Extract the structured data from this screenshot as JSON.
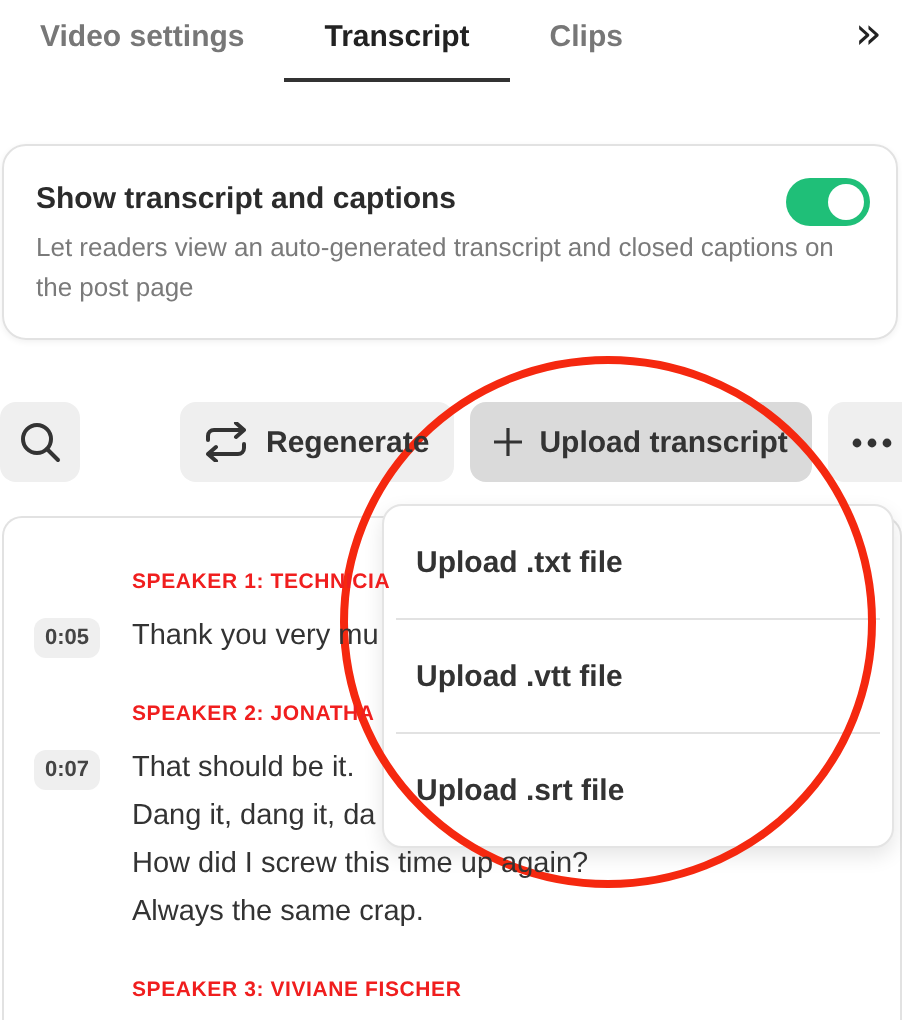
{
  "tabs": [
    {
      "label": "Video settings",
      "selected": false
    },
    {
      "label": "Transcript",
      "selected": true
    },
    {
      "label": "Clips",
      "selected": false
    }
  ],
  "tabs_more": "»",
  "setting": {
    "title": "Show transcript and captions",
    "description": "Let readers view an auto-generated transcript and closed captions on the post page",
    "on": true
  },
  "toolbar": {
    "regenerate": "Regenerate",
    "upload": "Upload transcript",
    "upload_open": true
  },
  "upload_menu": {
    "items": [
      "Upload .txt file",
      "Upload .vtt file",
      "Upload .srt file"
    ]
  },
  "transcript": [
    {
      "speaker": "SPEAKER 1: TECHNICIA",
      "time": "0:05",
      "lines": [
        "Thank you very mu"
      ]
    },
    {
      "speaker": "SPEAKER 2: JONATHA",
      "time": "0:07",
      "lines": [
        "That should be it.",
        "Dang it, dang it, da",
        "How did I screw this time up again?",
        "Always the same crap."
      ]
    },
    {
      "speaker": "SPEAKER 3: VIVIANE FISCHER"
    }
  ],
  "annotation": {
    "kind": "circle",
    "color": "#f5280f"
  }
}
